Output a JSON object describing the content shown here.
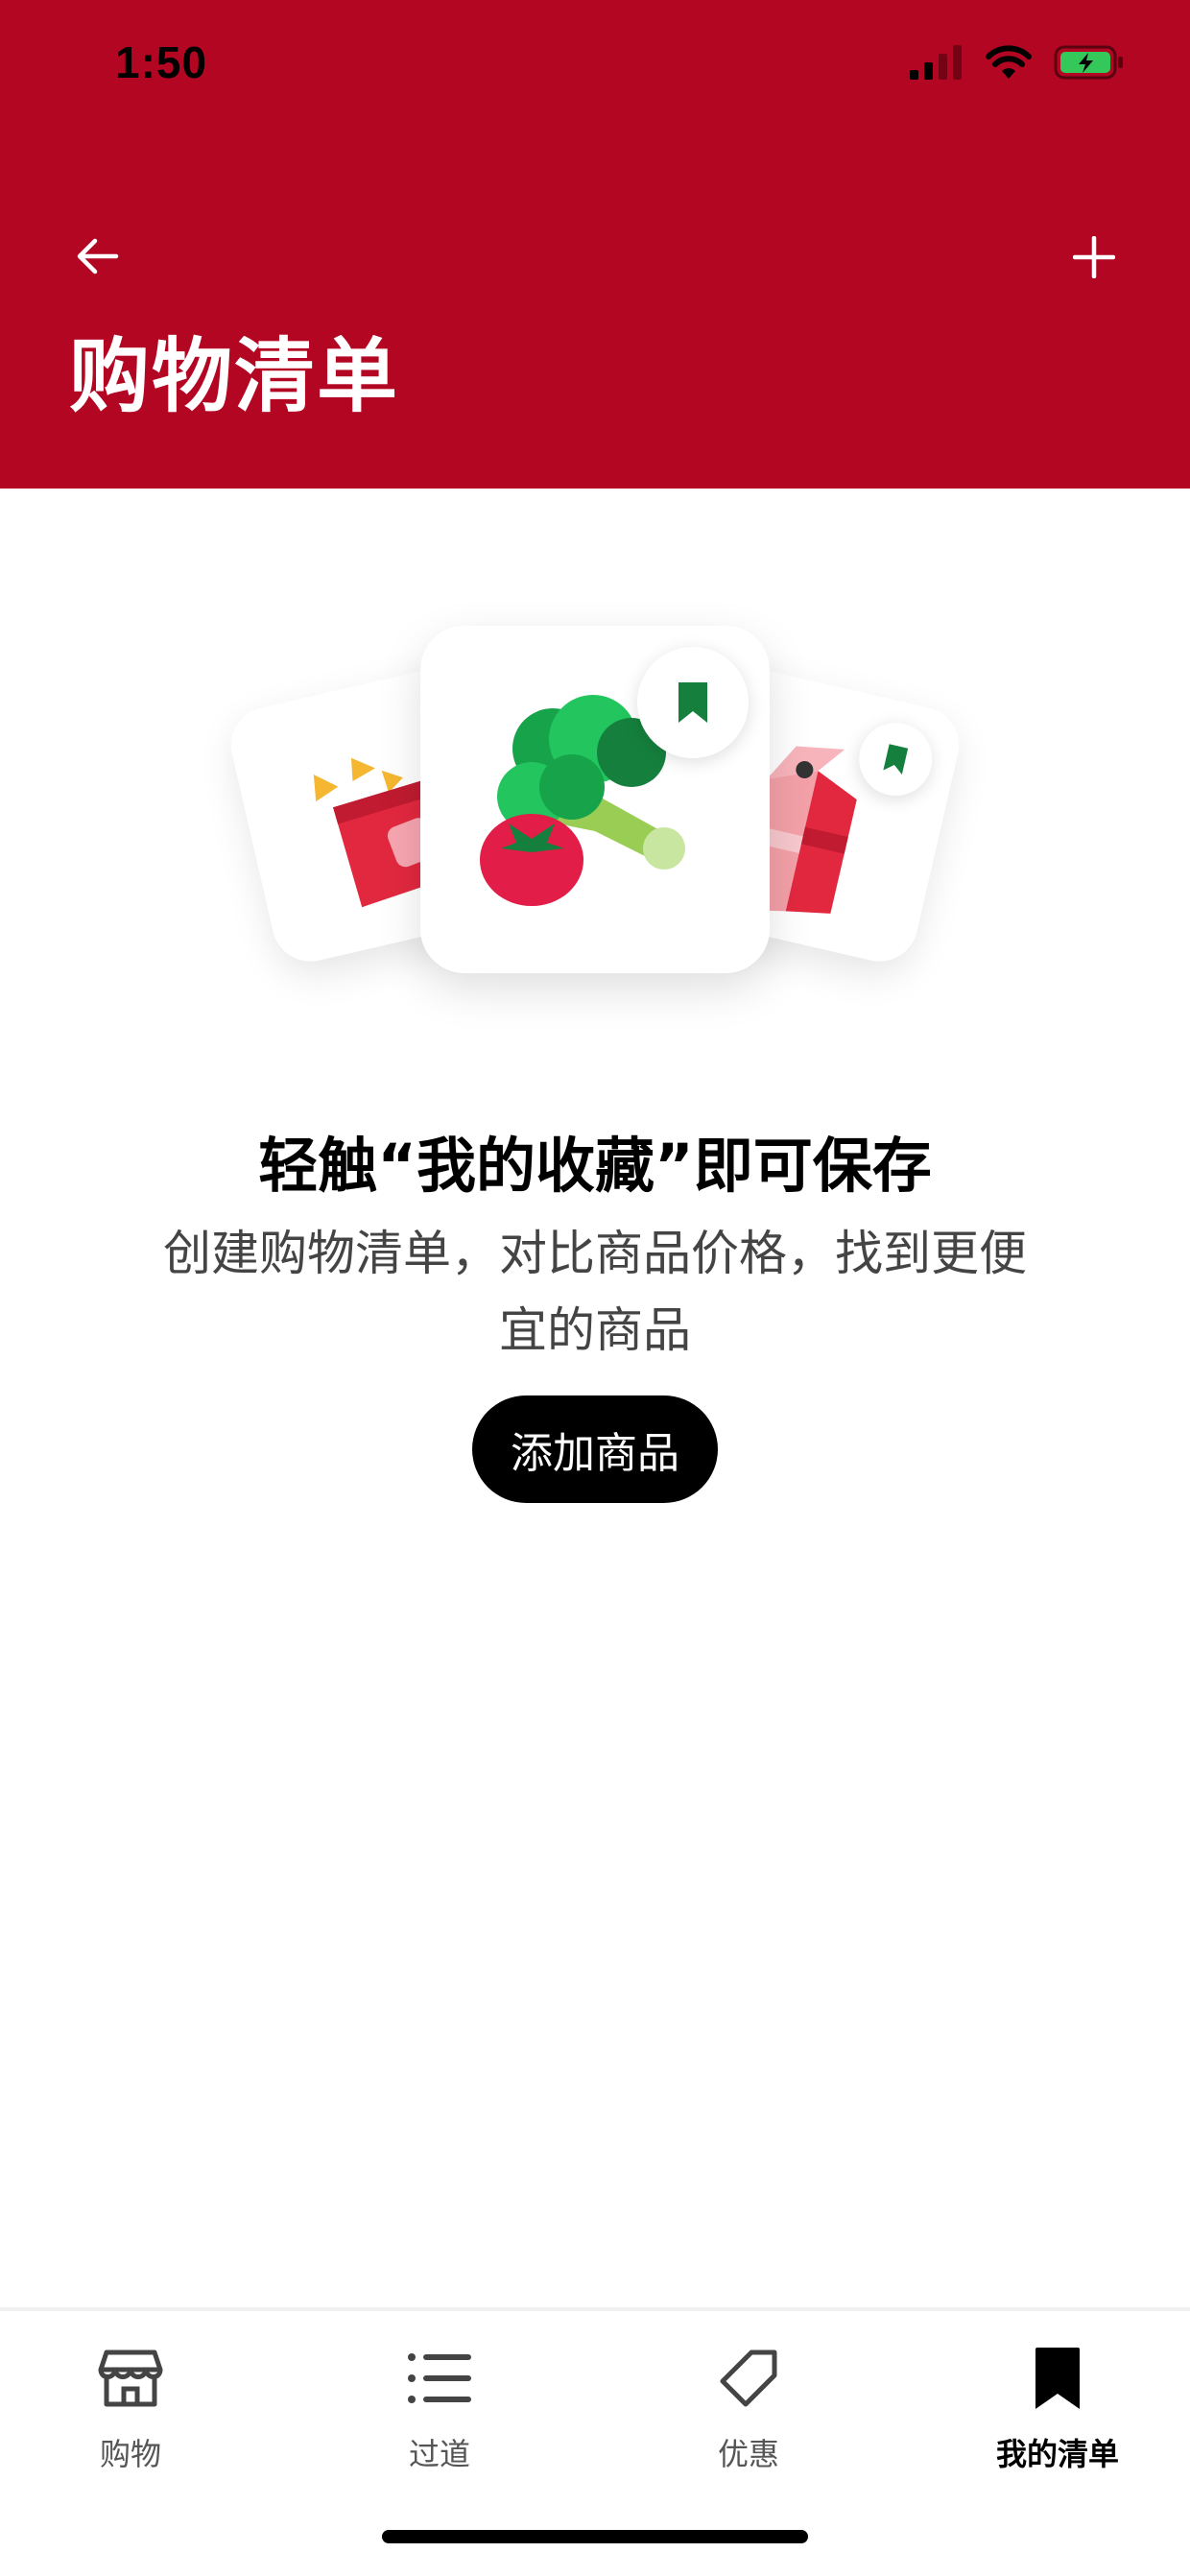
{
  "status_bar": {
    "time": "1:50"
  },
  "header": {
    "title": "购物清单",
    "back_icon": "arrow-left-icon",
    "add_icon": "plus-icon"
  },
  "empty_state": {
    "title": "轻触“我的收藏”即可保存",
    "description": "创建购物清单，对比商品价格，找到更便宜的商品",
    "button_label": "添加商品"
  },
  "tabs": [
    {
      "label": "购物",
      "icon": "store-icon",
      "active": false
    },
    {
      "label": "过道",
      "icon": "list-icon",
      "active": false
    },
    {
      "label": "优惠",
      "icon": "tag-icon",
      "active": false
    },
    {
      "label": "我的清单",
      "icon": "bookmark-icon",
      "active": true
    }
  ],
  "colors": {
    "brand": "#b30623",
    "bookmark_green": "#15803d",
    "button": "#000000"
  }
}
